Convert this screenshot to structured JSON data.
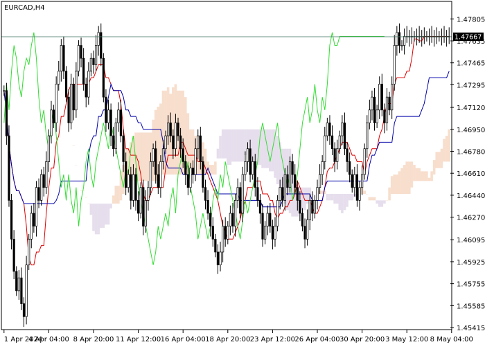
{
  "window": {
    "title": "EURCAD,H4"
  },
  "colors": {
    "background": "#ffffff",
    "frame": "#000000",
    "candle": "#000000",
    "tenkan": "#dd0000",
    "kijun": "#0000aa",
    "chikou": "#33dd33",
    "kumo_a": "#e8a070",
    "kumo_b": "#b8a0c8",
    "price_line": "#4a7a6a",
    "price_tag_bg": "#000000",
    "price_tag_text": "#ffffff"
  },
  "current_price": {
    "label": "1.47667",
    "value": 1.47667
  },
  "chart_data": {
    "type": "candlestick",
    "title": "EURCAD,H4",
    "ylim": [
      1.4541,
      1.4793
    ],
    "y_ticks": [
      "1.47805",
      "1.47635",
      "1.47465",
      "1.47295",
      "1.47120",
      "1.46950",
      "1.46780",
      "1.46610",
      "1.46440",
      "1.46270",
      "1.46095",
      "1.45925",
      "1.45755",
      "1.45585",
      "1.45415"
    ],
    "x_ticks": [
      "1 Apr 2024",
      "4 Apr 04:00",
      "8 Apr 20:00",
      "11 Apr 12:00",
      "16 Apr 04:00",
      "18 Apr 20:00",
      "23 Apr 12:00",
      "26 Apr 04:00",
      "30 Apr 20:00",
      "3 May 12:00",
      "8 May 04:00"
    ],
    "x_tick_index": [
      0,
      18,
      36,
      54,
      72,
      90,
      108,
      126,
      144,
      162,
      180
    ],
    "series": [
      {
        "name": "",
        "kind": "close",
        "values": [
          1.4725,
          1.469,
          1.464,
          1.461,
          1.4585,
          1.457,
          1.458,
          1.456,
          1.455,
          1.459,
          1.461,
          1.463,
          1.462,
          1.465,
          1.464,
          1.466,
          1.465,
          1.467,
          1.469,
          1.471,
          1.47,
          1.473,
          1.474,
          1.476,
          1.474,
          1.472,
          1.47,
          1.473,
          1.471,
          1.474,
          1.476,
          1.475,
          1.473,
          1.472,
          1.474,
          1.475,
          1.4745,
          1.476,
          1.477,
          1.475,
          1.472,
          1.47,
          1.471,
          1.469,
          1.468,
          1.47,
          1.471,
          1.469,
          1.467,
          1.465,
          1.466,
          1.464,
          1.466,
          1.464,
          1.463,
          1.465,
          1.462,
          1.464,
          1.465,
          1.467,
          1.468,
          1.466,
          1.465,
          1.467,
          1.468,
          1.469,
          1.47,
          1.469,
          1.468,
          1.47,
          1.469,
          1.468,
          1.467,
          1.466,
          1.465,
          1.4665,
          1.466,
          1.468,
          1.469,
          1.467,
          1.465,
          1.464,
          1.463,
          1.462,
          1.461,
          1.46,
          1.459,
          1.46,
          1.462,
          1.461,
          1.462,
          1.463,
          1.462,
          1.464,
          1.465,
          1.463,
          1.466,
          1.467,
          1.468,
          1.466,
          1.467,
          1.465,
          1.464,
          1.463,
          1.461,
          1.462,
          1.463,
          1.462,
          1.461,
          1.462,
          1.464,
          1.465,
          1.464,
          1.466,
          1.465,
          1.467,
          1.466,
          1.465,
          1.464,
          1.463,
          1.462,
          1.461,
          1.4625,
          1.464,
          1.463,
          1.464,
          1.465,
          1.466,
          1.467,
          1.469,
          1.47,
          1.469,
          1.468,
          1.467,
          1.468,
          1.469,
          1.47,
          1.468,
          1.467,
          1.466,
          1.465,
          1.466,
          1.464,
          1.465,
          1.466,
          1.468,
          1.47,
          1.471,
          1.472,
          1.47,
          1.471,
          1.473,
          1.471,
          1.47,
          1.472,
          1.471,
          1.473,
          1.476,
          1.477,
          1.476,
          1.476,
          1.4767,
          1.4767,
          1.4767,
          1.4767,
          1.4767,
          1.4767,
          1.4767,
          1.4767,
          1.4767,
          1.4767,
          1.4767,
          1.4767,
          1.4767,
          1.4767,
          1.4767,
          1.4767,
          1.4767,
          1.4767,
          1.4767
        ]
      }
    ],
    "grid": false,
    "legend": "none"
  }
}
